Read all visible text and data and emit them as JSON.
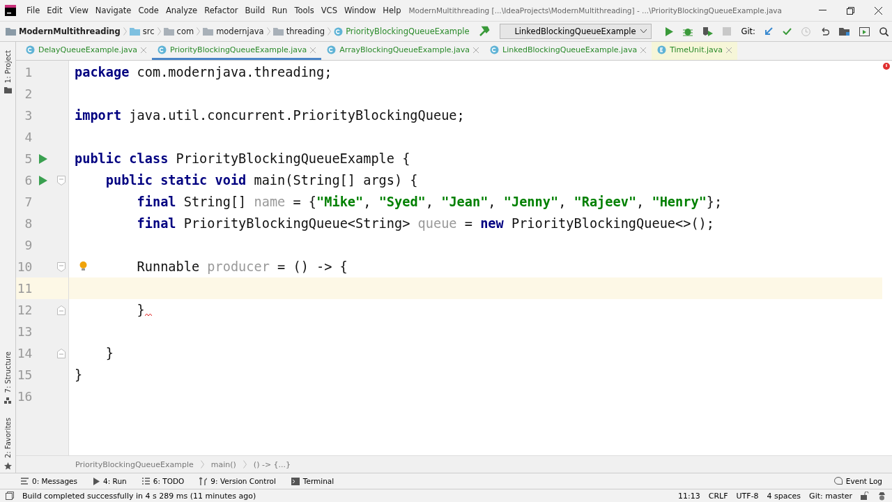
{
  "menu_bar": {
    "items": [
      "File",
      "Edit",
      "View",
      "Navigate",
      "Code",
      "Analyze",
      "Refactor",
      "Build",
      "Run",
      "Tools",
      "VCS",
      "Window",
      "Help"
    ],
    "title": "ModernMultithreading [...\\IdeaProjects\\ModernMultithreading] - ...\\PriorityBlockingQueueExample.java"
  },
  "breadcrumbs": [
    {
      "label": "ModernMultithreading",
      "kind": "project"
    },
    {
      "label": "src",
      "kind": "source"
    },
    {
      "label": "com",
      "kind": "folder"
    },
    {
      "label": "modernjava",
      "kind": "folder"
    },
    {
      "label": "threading",
      "kind": "folder"
    },
    {
      "label": "PriorityBlockingQueueExample",
      "kind": "class"
    }
  ],
  "toolbar": {
    "run_config": "LinkedBlockingQueueExample",
    "git_label": "Git:"
  },
  "tabs": [
    {
      "label": "DelayQueueExample.java",
      "kind": "class",
      "selected": false
    },
    {
      "label": "PriorityBlockingQueueExample.java",
      "kind": "class",
      "selected": true
    },
    {
      "label": "ArrayBlockingQueueExample.java",
      "kind": "class",
      "selected": false
    },
    {
      "label": "LinkedBlockingQueueExample.java",
      "kind": "class",
      "selected": false
    },
    {
      "label": "TimeUnit.java",
      "kind": "enum",
      "selected": false
    }
  ],
  "side_tools": {
    "top": "1: Project",
    "bottom": [
      "7: Structure",
      "2: Favorites"
    ]
  },
  "editor": {
    "lines": [
      {
        "number": "1",
        "tokens": [
          {
            "kind": "kw",
            "text": "package"
          },
          {
            "kind": "text",
            "text": " com.modernjava.threading;"
          }
        ]
      },
      {
        "number": "2"
      },
      {
        "number": "3",
        "tokens": [
          {
            "kind": "kw",
            "text": "import"
          },
          {
            "kind": "text",
            "text": " java.util.concurrent.PriorityBlockingQueue;"
          }
        ]
      },
      {
        "number": "4"
      },
      {
        "number": "5",
        "run": true,
        "tokens": [
          {
            "kind": "kw",
            "text": "public class"
          },
          {
            "kind": "text",
            "text": " PriorityBlockingQueueExample {"
          }
        ]
      },
      {
        "number": "6",
        "run": true,
        "fold_start": true,
        "tokens": [
          {
            "kind": "kw",
            "text": "    public static void"
          },
          {
            "kind": "text",
            "text": " main(String[] args) {"
          }
        ]
      },
      {
        "number": "7",
        "tokens": [
          {
            "kind": "kw",
            "text": "        final"
          },
          {
            "kind": "text",
            "text": " String[] "
          },
          {
            "kind": "unused",
            "text": "name"
          },
          {
            "kind": "text",
            "text": " = {"
          },
          {
            "kind": "str",
            "text": "\"Mike\""
          },
          {
            "kind": "text",
            "text": ", "
          },
          {
            "kind": "str",
            "text": "\"Syed\""
          },
          {
            "kind": "text",
            "text": ", "
          },
          {
            "kind": "str",
            "text": "\"Jean\""
          },
          {
            "kind": "text",
            "text": ", "
          },
          {
            "kind": "str",
            "text": "\"Jenny\""
          },
          {
            "kind": "text",
            "text": ", "
          },
          {
            "kind": "str",
            "text": "\"Rajeev\""
          },
          {
            "kind": "text",
            "text": ", "
          },
          {
            "kind": "str",
            "text": "\"Henry\""
          },
          {
            "kind": "text",
            "text": "};"
          }
        ]
      },
      {
        "number": "8",
        "tokens": [
          {
            "kind": "kw",
            "text": "        final"
          },
          {
            "kind": "text",
            "text": " PriorityBlockingQueue<String> "
          },
          {
            "kind": "unused",
            "text": "queue"
          },
          {
            "kind": "text",
            "text": " = "
          },
          {
            "kind": "kw",
            "text": "new"
          },
          {
            "kind": "text",
            "text": " PriorityBlockingQueue<>();"
          }
        ]
      },
      {
        "number": "9"
      },
      {
        "number": "10",
        "fold_start": true,
        "bulb": true,
        "tokens": [
          {
            "kind": "text",
            "text": "        Runnable "
          },
          {
            "kind": "unused",
            "text": "producer"
          },
          {
            "kind": "text",
            "text": " = () -> {"
          }
        ]
      },
      {
        "number": "11",
        "current": true
      },
      {
        "number": "12",
        "fold_end": true,
        "error": true,
        "tokens": [
          {
            "kind": "text",
            "text": "        }"
          }
        ]
      },
      {
        "number": "13"
      },
      {
        "number": "14",
        "fold_end": true,
        "tokens": [
          {
            "kind": "text",
            "text": "    }"
          }
        ]
      },
      {
        "number": "15",
        "tokens": [
          {
            "kind": "text",
            "text": "}"
          }
        ]
      },
      {
        "number": "16"
      }
    ]
  },
  "editor_breadcrumbs": [
    "PriorityBlockingQueueExample",
    "main()",
    "() -> {...}"
  ],
  "tool_windows": [
    {
      "label": "0: Messages",
      "kind": "messages"
    },
    {
      "label": "4: Run",
      "kind": "run"
    },
    {
      "label": "6: TODO",
      "kind": "todo"
    },
    {
      "label": "9: Version Control",
      "kind": "vcs"
    },
    {
      "label": "Terminal",
      "kind": "terminal"
    }
  ],
  "event_log": "Event Log",
  "status_bar": {
    "message": "Build completed successfully in 4 s 289 ms (11 minutes ago)",
    "items": [
      "11:13",
      "CRLF",
      "UTF-8",
      "4 spaces",
      "Git: master"
    ]
  }
}
